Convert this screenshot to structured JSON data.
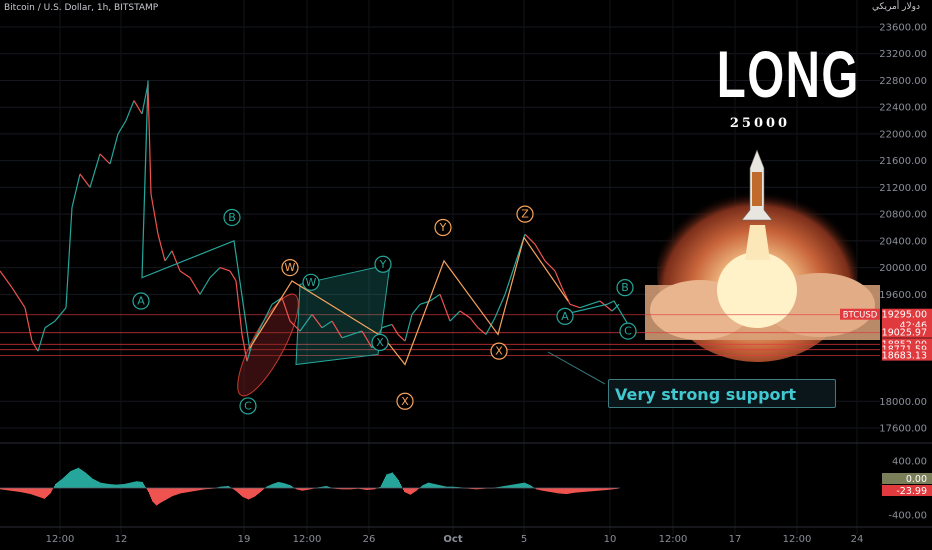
{
  "header": {
    "symbol_title": "Bitcoin / U.S. Dollar, 1h, BITSTAMP",
    "currency_label": "دولار أمريكي"
  },
  "annotation": {
    "long_word": "LONG",
    "target": "25000",
    "support_text": "Very strong support"
  },
  "chart_data": [
    {
      "type": "line",
      "title": "Bitcoin / U.S. Dollar, 1h, BITSTAMP",
      "price_axis": {
        "ticks": [
          "23600.00",
          "23200.00",
          "22800.00",
          "22400.00",
          "22000.00",
          "21600.00",
          "21200.00",
          "20800.00",
          "20400.00",
          "20000.00",
          "19600.00",
          "18000.00",
          "17600.00"
        ],
        "ylim": [
          17200,
          23800
        ]
      },
      "time_axis": {
        "ticks": [
          "12:00",
          "12",
          "19",
          "12:00",
          "26",
          "Oct",
          "5",
          "10",
          "12:00",
          "17",
          "12:00",
          "24"
        ]
      },
      "price_path": [
        [
          0,
          19950
        ],
        [
          12,
          19700
        ],
        [
          25,
          19400
        ],
        [
          32,
          18900
        ],
        [
          38,
          18750
        ],
        [
          45,
          19100
        ],
        [
          55,
          19200
        ],
        [
          66,
          19400
        ],
        [
          72,
          20900
        ],
        [
          80,
          21400
        ],
        [
          90,
          21200
        ],
        [
          100,
          21700
        ],
        [
          110,
          21550
        ],
        [
          118,
          22000
        ],
        [
          126,
          22200
        ],
        [
          134,
          22500
        ],
        [
          142,
          22300
        ],
        [
          148,
          22750
        ],
        [
          151,
          21100
        ],
        [
          158,
          20500
        ],
        [
          165,
          20100
        ],
        [
          172,
          20250
        ],
        [
          180,
          19950
        ],
        [
          190,
          19850
        ],
        [
          200,
          19600
        ],
        [
          210,
          19850
        ],
        [
          220,
          20000
        ],
        [
          230,
          19950
        ],
        [
          236,
          19800
        ],
        [
          242,
          19000
        ],
        [
          247,
          18600
        ],
        [
          252,
          18850
        ],
        [
          262,
          19150
        ],
        [
          272,
          19450
        ],
        [
          282,
          19550
        ],
        [
          290,
          19200
        ],
        [
          300,
          19050
        ],
        [
          312,
          19300
        ],
        [
          322,
          19100
        ],
        [
          332,
          19200
        ],
        [
          342,
          18950
        ],
        [
          352,
          19000
        ],
        [
          362,
          19050
        ],
        [
          372,
          18800
        ],
        [
          382,
          19100
        ],
        [
          392,
          19150
        ],
        [
          398,
          19000
        ],
        [
          405,
          18900
        ],
        [
          412,
          19300
        ],
        [
          420,
          19450
        ],
        [
          430,
          19500
        ],
        [
          440,
          19600
        ],
        [
          450,
          19200
        ],
        [
          460,
          19350
        ],
        [
          470,
          19250
        ],
        [
          478,
          19100
        ],
        [
          486,
          19000
        ],
        [
          495,
          19250
        ],
        [
          505,
          19600
        ],
        [
          515,
          20050
        ],
        [
          525,
          20500
        ],
        [
          535,
          20350
        ],
        [
          545,
          20100
        ],
        [
          555,
          19950
        ],
        [
          562,
          19700
        ],
        [
          570,
          19450
        ],
        [
          580,
          19400
        ],
        [
          590,
          19450
        ],
        [
          600,
          19500
        ],
        [
          612,
          19350
        ],
        [
          619,
          19450
        ]
      ],
      "wave_lines": [
        {
          "name": "green",
          "color": "#26a69a",
          "points": [
            [
              142,
              19850
            ],
            [
              148,
              22750
            ],
            [
              148,
              22800
            ],
            [
              142,
              19850
            ],
            [
              234,
              20400
            ],
            [
              250,
              18750
            ]
          ]
        },
        {
          "name": "green-2",
          "color": "#26a69a",
          "points": [
            [
              564,
              19300
            ],
            [
              607,
              19450
            ],
            [
              614,
              19500
            ],
            [
              628,
              19150
            ]
          ]
        },
        {
          "name": "orange",
          "color": "#f7a35c",
          "points": [
            [
              250,
              18800
            ],
            [
              292,
              19800
            ],
            [
              384,
              18950
            ],
            [
              405,
              18550
            ],
            [
              444,
              20100
            ],
            [
              498,
              19000
            ],
            [
              524,
              20450
            ],
            [
              568,
              19500
            ]
          ]
        }
      ],
      "channel_box": [
        [
          300,
          19750
        ],
        [
          390,
          20050
        ],
        [
          378,
          18700
        ],
        [
          296,
          18550
        ]
      ],
      "wave_labels": [
        {
          "text": "A",
          "price": 19500,
          "x": 141,
          "color": "#26a69a"
        },
        {
          "text": "B",
          "price": 20750,
          "x": 232,
          "color": "#26a69a"
        },
        {
          "text": "C",
          "price": 17930,
          "x": 248,
          "color": "#26a69a"
        },
        {
          "text": "W",
          "price": 20000,
          "x": 290,
          "color": "#f7a35c"
        },
        {
          "text": "W",
          "price": 19780,
          "x": 311,
          "color": "#26a69a"
        },
        {
          "text": "X",
          "price": 18880,
          "x": 380,
          "color": "#26a69a"
        },
        {
          "text": "Y",
          "price": 20050,
          "x": 383,
          "color": "#26a69a"
        },
        {
          "text": "X",
          "price": 18000,
          "x": 405,
          "color": "#f7a35c"
        },
        {
          "text": "Y",
          "price": 20600,
          "x": 443,
          "color": "#f7a35c"
        },
        {
          "text": "Z",
          "price": 20800,
          "x": 525,
          "color": "#f7a35c"
        },
        {
          "text": "X",
          "price": 18750,
          "x": 499,
          "color": "#f7a35c"
        },
        {
          "text": "A",
          "price": 19270,
          "x": 565,
          "color": "#26a69a"
        },
        {
          "text": "B",
          "price": 19700,
          "x": 625,
          "color": "#26a69a"
        },
        {
          "text": "C",
          "price": 19050,
          "x": 628,
          "color": "#26a69a"
        }
      ],
      "levels": [
        {
          "price": 19295.0,
          "label": "19295.00",
          "color": "#e03a3e",
          "badge": "BTCUSD",
          "sub": "42:46"
        },
        {
          "price": 19025.97,
          "label": "19025.97",
          "color": "#e03a3e"
        },
        {
          "price": 18852.0,
          "label": "18852.00",
          "color": "#e03a3e"
        },
        {
          "price": 18771.59,
          "label": "18771.59",
          "color": "#e03a3e"
        },
        {
          "price": 18683.13,
          "label": "18683.13",
          "color": "#e03a3e"
        }
      ],
      "colors": {
        "up": "#26a69a",
        "down": "#ef5350",
        "level": "#e03a3e",
        "support": "#42c8d0",
        "orange": "#f7a35c"
      }
    },
    {
      "type": "bar",
      "name": "oscillator",
      "ylim": [
        -400,
        400
      ],
      "ticks": [
        "400.00",
        "-400.00"
      ],
      "last_values": [
        {
          "label": "0.00",
          "color": "#7a7f5a"
        },
        {
          "label": "-23.99",
          "color": "#e03a3e"
        }
      ],
      "histogram": [
        [
          0,
          -20
        ],
        [
          10,
          -40
        ],
        [
          20,
          -60
        ],
        [
          30,
          -90
        ],
        [
          38,
          -130
        ],
        [
          44,
          -160
        ],
        [
          50,
          -80
        ],
        [
          55,
          60
        ],
        [
          62,
          140
        ],
        [
          70,
          250
        ],
        [
          78,
          300
        ],
        [
          85,
          230
        ],
        [
          92,
          140
        ],
        [
          100,
          80
        ],
        [
          108,
          60
        ],
        [
          116,
          50
        ],
        [
          124,
          60
        ],
        [
          130,
          80
        ],
        [
          136,
          100
        ],
        [
          142,
          90
        ],
        [
          148,
          -60
        ],
        [
          152,
          -200
        ],
        [
          156,
          -260
        ],
        [
          160,
          -220
        ],
        [
          166,
          -170
        ],
        [
          172,
          -120
        ],
        [
          180,
          -80
        ],
        [
          188,
          -60
        ],
        [
          196,
          -40
        ],
        [
          204,
          -20
        ],
        [
          212,
          -10
        ],
        [
          220,
          20
        ],
        [
          228,
          30
        ],
        [
          236,
          -50
        ],
        [
          242,
          -130
        ],
        [
          248,
          -170
        ],
        [
          254,
          -130
        ],
        [
          260,
          -60
        ],
        [
          266,
          20
        ],
        [
          272,
          60
        ],
        [
          278,
          90
        ],
        [
          284,
          70
        ],
        [
          290,
          40
        ],
        [
          296,
          -20
        ],
        [
          302,
          -40
        ],
        [
          310,
          -20
        ],
        [
          318,
          10
        ],
        [
          326,
          30
        ],
        [
          334,
          -10
        ],
        [
          342,
          -20
        ],
        [
          350,
          -20
        ],
        [
          358,
          -10
        ],
        [
          366,
          -30
        ],
        [
          374,
          -20
        ],
        [
          380,
          20
        ],
        [
          386,
          200
        ],
        [
          392,
          230
        ],
        [
          398,
          120
        ],
        [
          404,
          -60
        ],
        [
          410,
          -100
        ],
        [
          416,
          -40
        ],
        [
          422,
          40
        ],
        [
          428,
          80
        ],
        [
          434,
          60
        ],
        [
          440,
          40
        ],
        [
          446,
          20
        ],
        [
          452,
          20
        ],
        [
          460,
          10
        ],
        [
          468,
          -10
        ],
        [
          476,
          -20
        ],
        [
          484,
          -10
        ],
        [
          492,
          0
        ],
        [
          500,
          20
        ],
        [
          508,
          40
        ],
        [
          516,
          60
        ],
        [
          524,
          80
        ],
        [
          530,
          40
        ],
        [
          536,
          -20
        ],
        [
          542,
          -40
        ],
        [
          550,
          -60
        ],
        [
          558,
          -80
        ],
        [
          566,
          -90
        ],
        [
          574,
          -70
        ],
        [
          582,
          -60
        ],
        [
          590,
          -50
        ],
        [
          598,
          -40
        ],
        [
          606,
          -30
        ],
        [
          612,
          -20
        ],
        [
          618,
          -10
        ]
      ]
    }
  ]
}
